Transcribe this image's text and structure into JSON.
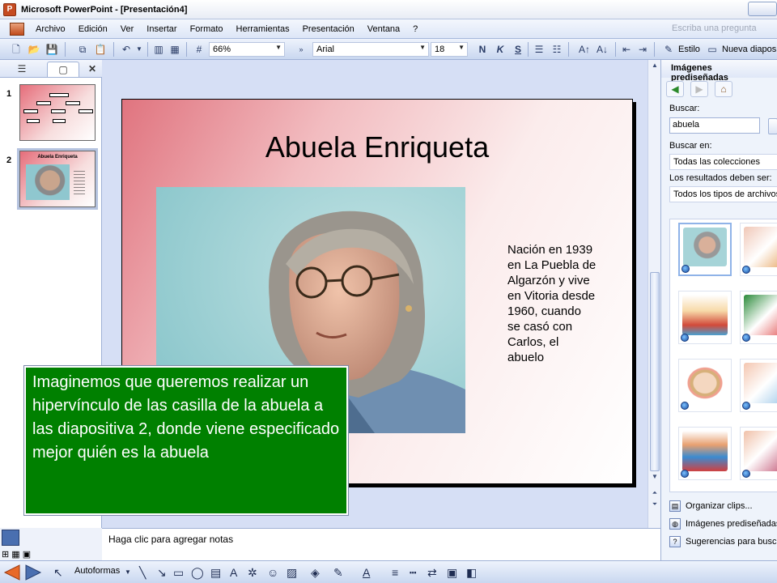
{
  "window": {
    "title": "Microsoft PowerPoint - [Presentación4]"
  },
  "menu": {
    "items": [
      "Archivo",
      "Edición",
      "Ver",
      "Insertar",
      "Formato",
      "Herramientas",
      "Presentación",
      "Ventana",
      "?"
    ],
    "help_placeholder": "Escriba una pregunta"
  },
  "toolbar": {
    "zoom": "66%",
    "font": "Arial",
    "font_size": "18",
    "bold": "N",
    "italic": "K",
    "shadow": "S",
    "style_label": "Estilo",
    "new_slide_label": "Nueva diapos"
  },
  "thumbnails": [
    {
      "number": "1",
      "title": ""
    },
    {
      "number": "2",
      "title": "Abuela Enriqueta"
    }
  ],
  "slide": {
    "title": "Abuela Enriqueta",
    "body": "Nación en 1939 en La Puebla de Algarzón y vive en Vitoria desde 1960, cuando se casó con Carlos, el abuelo"
  },
  "callout": {
    "text": "Imaginemos que queremos realizar un hipervínculo de las casilla de la abuela a las diapositiva 2, donde viene especificado mejor quién es la abuela"
  },
  "notes": {
    "placeholder": "Haga clic para agregar notas"
  },
  "taskpane": {
    "title": "Imágenes prediseñadas",
    "search_label": "Buscar:",
    "search_value": "abuela",
    "search_in_label": "Buscar en:",
    "search_in_value": "Todas las colecciones",
    "results_label": "Los resultados deben ser:",
    "results_value": "Todos los tipos de archivos",
    "links": [
      "Organizar clips...",
      "Imágenes prediseñadas",
      "Sugerencias para busca"
    ]
  },
  "drawing": {
    "autoshapes_label": "Autoformas"
  },
  "colors": {
    "callout_bg": "#008000",
    "slide_gradient_start": "#e0747f",
    "chrome_blue": "#d6dff5"
  }
}
